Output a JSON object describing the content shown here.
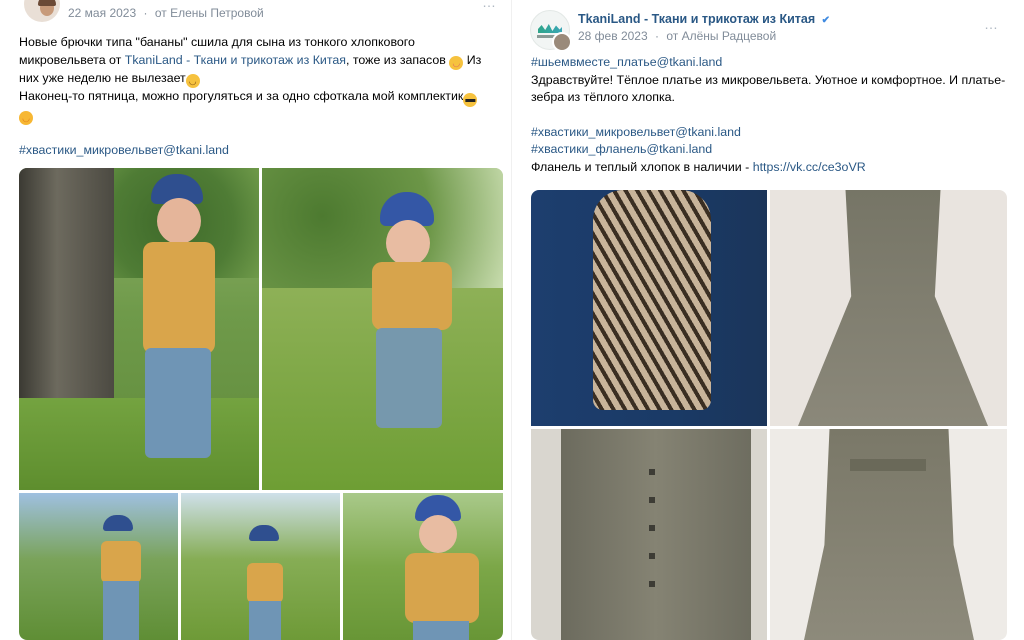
{
  "left_post": {
    "date": "22 мая 2023",
    "separator": "·",
    "from_label": "от Елены Петровой",
    "more_icon": "…",
    "lines": {
      "l1": "Новые брючки типа \"бананы\" сшила для сына из тонкого хлопкового",
      "l2a": "микровельвета от ",
      "l2_link": "TkaniLand - Ткани и трикотаж из Китая",
      "l2b": ", тоже из запасов",
      "l2c": " Из",
      "l3": "них уже неделю не вылезает",
      "l4": "Наконец-то пятница, можно прогуляться и за одно сфоткала мой комплектик"
    },
    "hashtag": "#хвастики_микровельвет@tkani.land",
    "emoji": {
      "blush": "smiling-blush-emoji",
      "grin": "grinning-emoji",
      "sunglasses": "sunglasses-emoji",
      "sun": "sun-emoji"
    }
  },
  "right_post": {
    "group_name": "TkaniLand - Ткани и трикотаж из Китая",
    "verified_icon": "✔",
    "date": "28 фев 2023",
    "separator": "·",
    "from_label": "от Алёны Радцевой",
    "more_icon": "…",
    "hashtag1": "#шьемвместе_платье@tkani.land",
    "para1": "Здравствуйте! Тёплое платье из микровельвета. Уютное и комфортное. И платье-",
    "para1b": "зебра из тёплого хлопка.",
    "hashtag2": "#хвастики_микровельвет@tkani.land",
    "hashtag3": "#хвастики_фланель@tkani.land",
    "stock_text": "Фланель и теплый хлопок в наличии - ",
    "stock_link": "https://vk.cc/ce3oVR"
  },
  "colors": {
    "link": "#2a5885",
    "meta": "#818c99",
    "verified": "#3f8ae0"
  }
}
